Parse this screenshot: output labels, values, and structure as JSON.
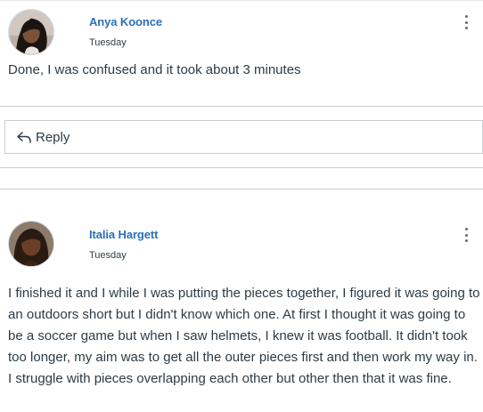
{
  "posts": [
    {
      "author": "Anya Koonce",
      "date": "Tuesday",
      "message": "Done, I was confused and it took about 3 minutes"
    },
    {
      "author": "Italia Hargett",
      "date": "Tuesday",
      "message": "I finished it and I while I was putting the pieces together, I figured it was going to an outdoors short but I didn't know which one. At first I thought it was going to be a soccer game but when I saw helmets, I knew it was football. It didn't took too longer, my aim was to get all the outer pieces first and then work my way in. I struggle with pieces overlapping each other but other then that it was fine."
    }
  ],
  "reply": {
    "label": "Reply",
    "icon": "reply-arrow-icon"
  },
  "icons": {
    "more": "kebab-menu-icon"
  },
  "colors": {
    "author_link": "#2c6fb7",
    "text": "#2d3b45",
    "border": "#c7cdd1"
  }
}
